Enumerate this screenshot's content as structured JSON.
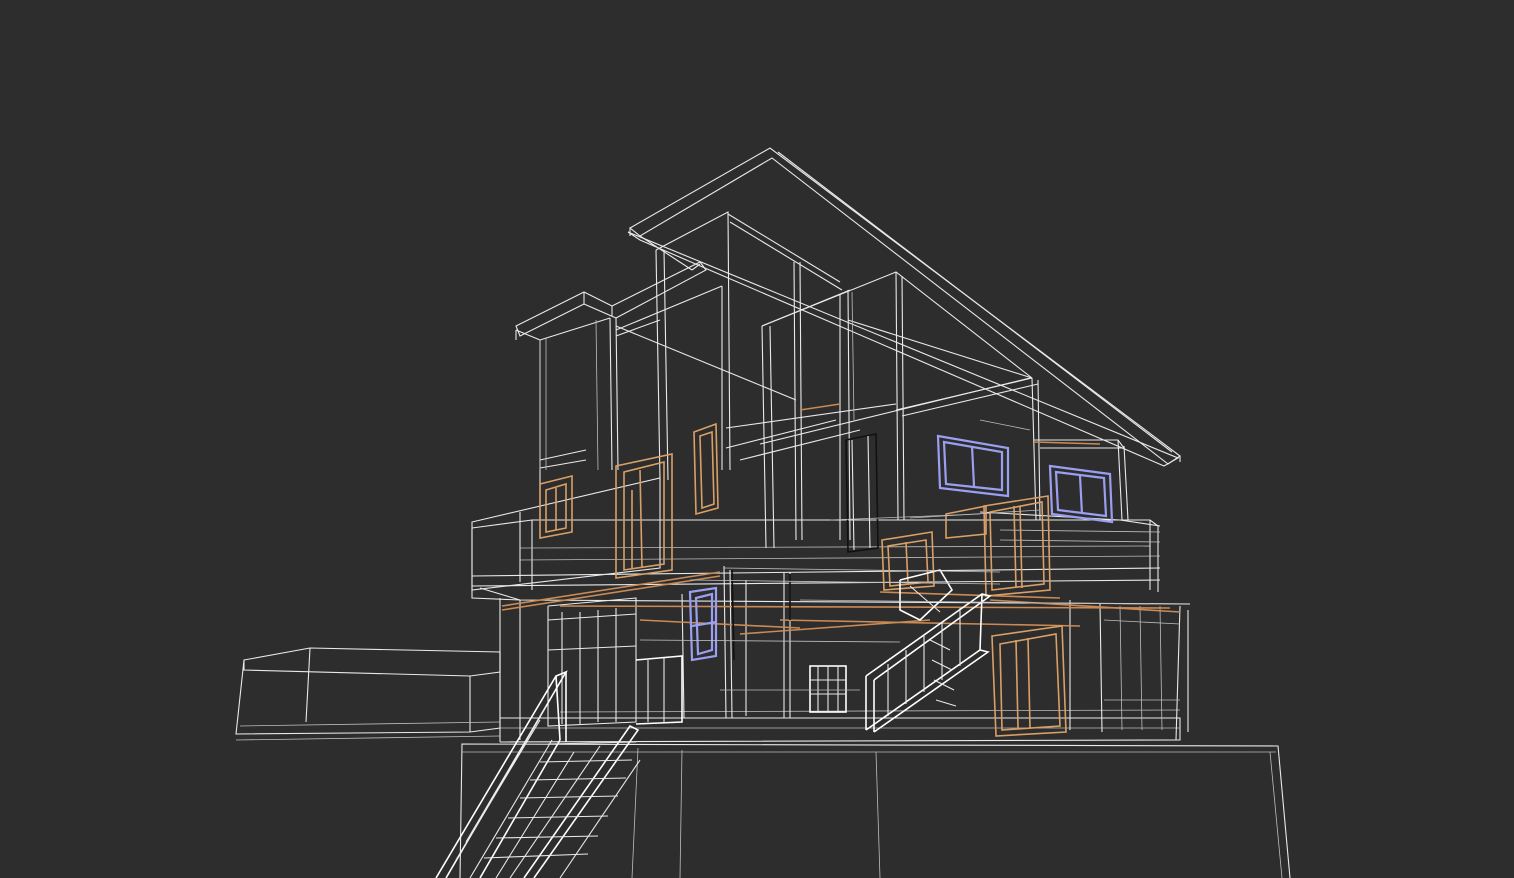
{
  "viewport": {
    "background": "#2d2d2d",
    "render_mode": "wireframe"
  },
  "colors": {
    "edge": "#e9e9e9",
    "door_frame": "#d9a066",
    "beam": "#c98a55",
    "window_frame": "#9b9ff0",
    "dark_element": "#111111"
  },
  "scene": {
    "subject": "two-storey-house-wireframe-model"
  }
}
